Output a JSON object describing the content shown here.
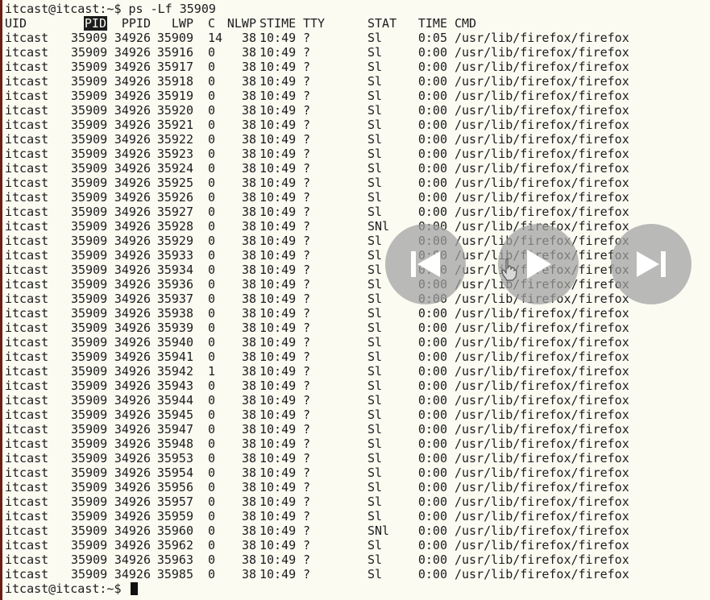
{
  "terminal": {
    "command_line": "itcast@itcast:~$ ps -Lf 35909",
    "prompt": "itcast@itcast:~$",
    "headers": {
      "uid": "UID",
      "pid": "PID",
      "ppid": "PPID",
      "lwp": "LWP",
      "c": "C",
      "nlwp": "NLWP",
      "stime": "STIME",
      "tty": "TTY",
      "stat": "STAT",
      "time": "TIME",
      "cmd": "CMD"
    },
    "rows": [
      {
        "uid": "itcast",
        "pid": "35909",
        "ppid": "34926",
        "lwp": "35909",
        "c": "14",
        "nlwp": "38",
        "stime": "10:49",
        "tty": "?",
        "stat": "Sl",
        "time": "0:05",
        "cmd": "/usr/lib/firefox/firefox"
      },
      {
        "uid": "itcast",
        "pid": "35909",
        "ppid": "34926",
        "lwp": "35916",
        "c": "0",
        "nlwp": "38",
        "stime": "10:49",
        "tty": "?",
        "stat": "Sl",
        "time": "0:00",
        "cmd": "/usr/lib/firefox/firefox"
      },
      {
        "uid": "itcast",
        "pid": "35909",
        "ppid": "34926",
        "lwp": "35917",
        "c": "0",
        "nlwp": "38",
        "stime": "10:49",
        "tty": "?",
        "stat": "Sl",
        "time": "0:00",
        "cmd": "/usr/lib/firefox/firefox"
      },
      {
        "uid": "itcast",
        "pid": "35909",
        "ppid": "34926",
        "lwp": "35918",
        "c": "0",
        "nlwp": "38",
        "stime": "10:49",
        "tty": "?",
        "stat": "Sl",
        "time": "0:00",
        "cmd": "/usr/lib/firefox/firefox"
      },
      {
        "uid": "itcast",
        "pid": "35909",
        "ppid": "34926",
        "lwp": "35919",
        "c": "0",
        "nlwp": "38",
        "stime": "10:49",
        "tty": "?",
        "stat": "Sl",
        "time": "0:00",
        "cmd": "/usr/lib/firefox/firefox"
      },
      {
        "uid": "itcast",
        "pid": "35909",
        "ppid": "34926",
        "lwp": "35920",
        "c": "0",
        "nlwp": "38",
        "stime": "10:49",
        "tty": "?",
        "stat": "Sl",
        "time": "0:00",
        "cmd": "/usr/lib/firefox/firefox"
      },
      {
        "uid": "itcast",
        "pid": "35909",
        "ppid": "34926",
        "lwp": "35921",
        "c": "0",
        "nlwp": "38",
        "stime": "10:49",
        "tty": "?",
        "stat": "Sl",
        "time": "0:00",
        "cmd": "/usr/lib/firefox/firefox"
      },
      {
        "uid": "itcast",
        "pid": "35909",
        "ppid": "34926",
        "lwp": "35922",
        "c": "0",
        "nlwp": "38",
        "stime": "10:49",
        "tty": "?",
        "stat": "Sl",
        "time": "0:00",
        "cmd": "/usr/lib/firefox/firefox"
      },
      {
        "uid": "itcast",
        "pid": "35909",
        "ppid": "34926",
        "lwp": "35923",
        "c": "0",
        "nlwp": "38",
        "stime": "10:49",
        "tty": "?",
        "stat": "Sl",
        "time": "0:00",
        "cmd": "/usr/lib/firefox/firefox"
      },
      {
        "uid": "itcast",
        "pid": "35909",
        "ppid": "34926",
        "lwp": "35924",
        "c": "0",
        "nlwp": "38",
        "stime": "10:49",
        "tty": "?",
        "stat": "Sl",
        "time": "0:00",
        "cmd": "/usr/lib/firefox/firefox"
      },
      {
        "uid": "itcast",
        "pid": "35909",
        "ppid": "34926",
        "lwp": "35925",
        "c": "0",
        "nlwp": "38",
        "stime": "10:49",
        "tty": "?",
        "stat": "Sl",
        "time": "0:00",
        "cmd": "/usr/lib/firefox/firefox"
      },
      {
        "uid": "itcast",
        "pid": "35909",
        "ppid": "34926",
        "lwp": "35926",
        "c": "0",
        "nlwp": "38",
        "stime": "10:49",
        "tty": "?",
        "stat": "Sl",
        "time": "0:00",
        "cmd": "/usr/lib/firefox/firefox"
      },
      {
        "uid": "itcast",
        "pid": "35909",
        "ppid": "34926",
        "lwp": "35927",
        "c": "0",
        "nlwp": "38",
        "stime": "10:49",
        "tty": "?",
        "stat": "Sl",
        "time": "0:00",
        "cmd": "/usr/lib/firefox/firefox"
      },
      {
        "uid": "itcast",
        "pid": "35909",
        "ppid": "34926",
        "lwp": "35928",
        "c": "0",
        "nlwp": "38",
        "stime": "10:49",
        "tty": "?",
        "stat": "SNl",
        "time": "0:00",
        "cmd": "/usr/lib/firefox/firefox"
      },
      {
        "uid": "itcast",
        "pid": "35909",
        "ppid": "34926",
        "lwp": "35929",
        "c": "0",
        "nlwp": "38",
        "stime": "10:49",
        "tty": "?",
        "stat": "Sl",
        "time": "0:00",
        "cmd": "/usr/lib/firefox/firefox"
      },
      {
        "uid": "itcast",
        "pid": "35909",
        "ppid": "34926",
        "lwp": "35933",
        "c": "0",
        "nlwp": "38",
        "stime": "10:49",
        "tty": "?",
        "stat": "Sl",
        "time": "0:00",
        "cmd": "/usr/lib/firefox/firefox"
      },
      {
        "uid": "itcast",
        "pid": "35909",
        "ppid": "34926",
        "lwp": "35934",
        "c": "0",
        "nlwp": "38",
        "stime": "10:49",
        "tty": "?",
        "stat": "Sl",
        "time": "0:00",
        "cmd": "/usr/lib/firefox/firefox"
      },
      {
        "uid": "itcast",
        "pid": "35909",
        "ppid": "34926",
        "lwp": "35936",
        "c": "0",
        "nlwp": "38",
        "stime": "10:49",
        "tty": "?",
        "stat": "Sl",
        "time": "0:00",
        "cmd": "/usr/lib/firefox/firefox"
      },
      {
        "uid": "itcast",
        "pid": "35909",
        "ppid": "34926",
        "lwp": "35937",
        "c": "0",
        "nlwp": "38",
        "stime": "10:49",
        "tty": "?",
        "stat": "Sl",
        "time": "0:00",
        "cmd": "/usr/lib/firefox/firefox"
      },
      {
        "uid": "itcast",
        "pid": "35909",
        "ppid": "34926",
        "lwp": "35938",
        "c": "0",
        "nlwp": "38",
        "stime": "10:49",
        "tty": "?",
        "stat": "Sl",
        "time": "0:00",
        "cmd": "/usr/lib/firefox/firefox"
      },
      {
        "uid": "itcast",
        "pid": "35909",
        "ppid": "34926",
        "lwp": "35939",
        "c": "0",
        "nlwp": "38",
        "stime": "10:49",
        "tty": "?",
        "stat": "Sl",
        "time": "0:00",
        "cmd": "/usr/lib/firefox/firefox"
      },
      {
        "uid": "itcast",
        "pid": "35909",
        "ppid": "34926",
        "lwp": "35940",
        "c": "0",
        "nlwp": "38",
        "stime": "10:49",
        "tty": "?",
        "stat": "Sl",
        "time": "0:00",
        "cmd": "/usr/lib/firefox/firefox"
      },
      {
        "uid": "itcast",
        "pid": "35909",
        "ppid": "34926",
        "lwp": "35941",
        "c": "0",
        "nlwp": "38",
        "stime": "10:49",
        "tty": "?",
        "stat": "Sl",
        "time": "0:00",
        "cmd": "/usr/lib/firefox/firefox"
      },
      {
        "uid": "itcast",
        "pid": "35909",
        "ppid": "34926",
        "lwp": "35942",
        "c": "1",
        "nlwp": "38",
        "stime": "10:49",
        "tty": "?",
        "stat": "Sl",
        "time": "0:00",
        "cmd": "/usr/lib/firefox/firefox"
      },
      {
        "uid": "itcast",
        "pid": "35909",
        "ppid": "34926",
        "lwp": "35943",
        "c": "0",
        "nlwp": "38",
        "stime": "10:49",
        "tty": "?",
        "stat": "Sl",
        "time": "0:00",
        "cmd": "/usr/lib/firefox/firefox"
      },
      {
        "uid": "itcast",
        "pid": "35909",
        "ppid": "34926",
        "lwp": "35944",
        "c": "0",
        "nlwp": "38",
        "stime": "10:49",
        "tty": "?",
        "stat": "Sl",
        "time": "0:00",
        "cmd": "/usr/lib/firefox/firefox"
      },
      {
        "uid": "itcast",
        "pid": "35909",
        "ppid": "34926",
        "lwp": "35945",
        "c": "0",
        "nlwp": "38",
        "stime": "10:49",
        "tty": "?",
        "stat": "Sl",
        "time": "0:00",
        "cmd": "/usr/lib/firefox/firefox"
      },
      {
        "uid": "itcast",
        "pid": "35909",
        "ppid": "34926",
        "lwp": "35947",
        "c": "0",
        "nlwp": "38",
        "stime": "10:49",
        "tty": "?",
        "stat": "Sl",
        "time": "0:00",
        "cmd": "/usr/lib/firefox/firefox"
      },
      {
        "uid": "itcast",
        "pid": "35909",
        "ppid": "34926",
        "lwp": "35948",
        "c": "0",
        "nlwp": "38",
        "stime": "10:49",
        "tty": "?",
        "stat": "Sl",
        "time": "0:00",
        "cmd": "/usr/lib/firefox/firefox"
      },
      {
        "uid": "itcast",
        "pid": "35909",
        "ppid": "34926",
        "lwp": "35953",
        "c": "0",
        "nlwp": "38",
        "stime": "10:49",
        "tty": "?",
        "stat": "Sl",
        "time": "0:00",
        "cmd": "/usr/lib/firefox/firefox"
      },
      {
        "uid": "itcast",
        "pid": "35909",
        "ppid": "34926",
        "lwp": "35954",
        "c": "0",
        "nlwp": "38",
        "stime": "10:49",
        "tty": "?",
        "stat": "Sl",
        "time": "0:00",
        "cmd": "/usr/lib/firefox/firefox"
      },
      {
        "uid": "itcast",
        "pid": "35909",
        "ppid": "34926",
        "lwp": "35956",
        "c": "0",
        "nlwp": "38",
        "stime": "10:49",
        "tty": "?",
        "stat": "Sl",
        "time": "0:00",
        "cmd": "/usr/lib/firefox/firefox"
      },
      {
        "uid": "itcast",
        "pid": "35909",
        "ppid": "34926",
        "lwp": "35957",
        "c": "0",
        "nlwp": "38",
        "stime": "10:49",
        "tty": "?",
        "stat": "Sl",
        "time": "0:00",
        "cmd": "/usr/lib/firefox/firefox"
      },
      {
        "uid": "itcast",
        "pid": "35909",
        "ppid": "34926",
        "lwp": "35959",
        "c": "0",
        "nlwp": "38",
        "stime": "10:49",
        "tty": "?",
        "stat": "Sl",
        "time": "0:00",
        "cmd": "/usr/lib/firefox/firefox"
      },
      {
        "uid": "itcast",
        "pid": "35909",
        "ppid": "34926",
        "lwp": "35960",
        "c": "0",
        "nlwp": "38",
        "stime": "10:49",
        "tty": "?",
        "stat": "SNl",
        "time": "0:00",
        "cmd": "/usr/lib/firefox/firefox"
      },
      {
        "uid": "itcast",
        "pid": "35909",
        "ppid": "34926",
        "lwp": "35962",
        "c": "0",
        "nlwp": "38",
        "stime": "10:49",
        "tty": "?",
        "stat": "Sl",
        "time": "0:00",
        "cmd": "/usr/lib/firefox/firefox"
      },
      {
        "uid": "itcast",
        "pid": "35909",
        "ppid": "34926",
        "lwp": "35963",
        "c": "0",
        "nlwp": "38",
        "stime": "10:49",
        "tty": "?",
        "stat": "Sl",
        "time": "0:00",
        "cmd": "/usr/lib/firefox/firefox"
      },
      {
        "uid": "itcast",
        "pid": "35909",
        "ppid": "34926",
        "lwp": "35985",
        "c": "0",
        "nlwp": "38",
        "stime": "10:49",
        "tty": "?",
        "stat": "Sl",
        "time": "0:00",
        "cmd": "/usr/lib/firefox/firefox"
      }
    ]
  },
  "media_controls": {
    "previous_icon": "skip-previous-icon",
    "play_icon": "play-icon",
    "next_icon": "skip-next-icon"
  },
  "colors": {
    "background": "#fbfbf2",
    "text": "#1c1c1c",
    "left_border": "#6b1f14",
    "overlay_button": "#a0a0a0"
  }
}
